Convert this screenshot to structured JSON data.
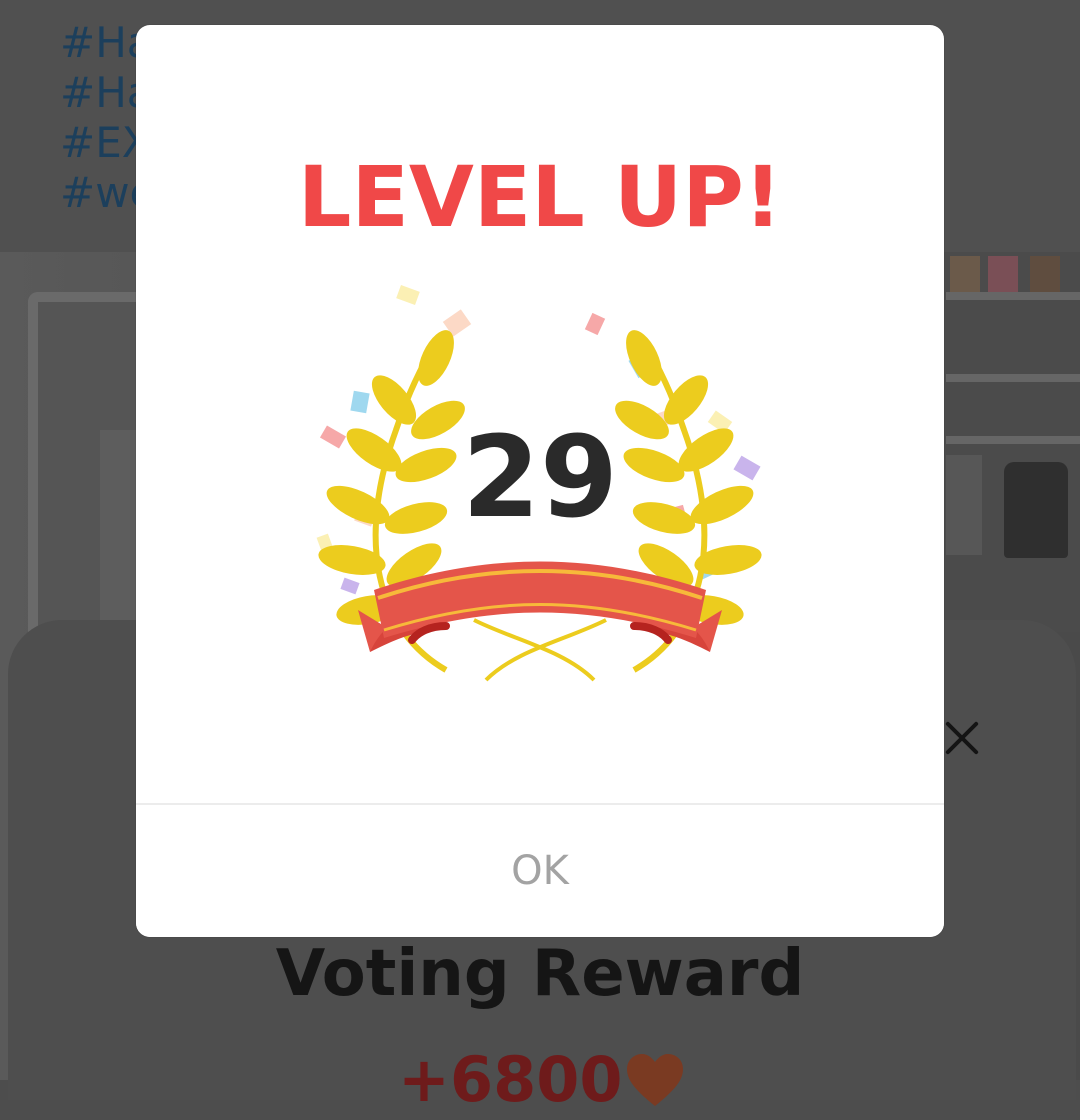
{
  "background": {
    "hashtags": [
      "#Ha",
      "#Ha",
      "#EX",
      "#we"
    ]
  },
  "reward_sheet": {
    "title": "Voting Reward",
    "reward_value": "+6800",
    "reward_icon": "heart-icon",
    "close_icon": "close-icon"
  },
  "level_up_modal": {
    "title": "LEVEL UP!",
    "level": "29",
    "badge_icon": "laurel-wreath-icon",
    "ok_label": "OK"
  },
  "colors": {
    "title_red": "#f04848",
    "laurel_yellow": "#eccc1e",
    "ribbon_red": "#e4554a",
    "ok_gray": "#a3a3a3"
  }
}
